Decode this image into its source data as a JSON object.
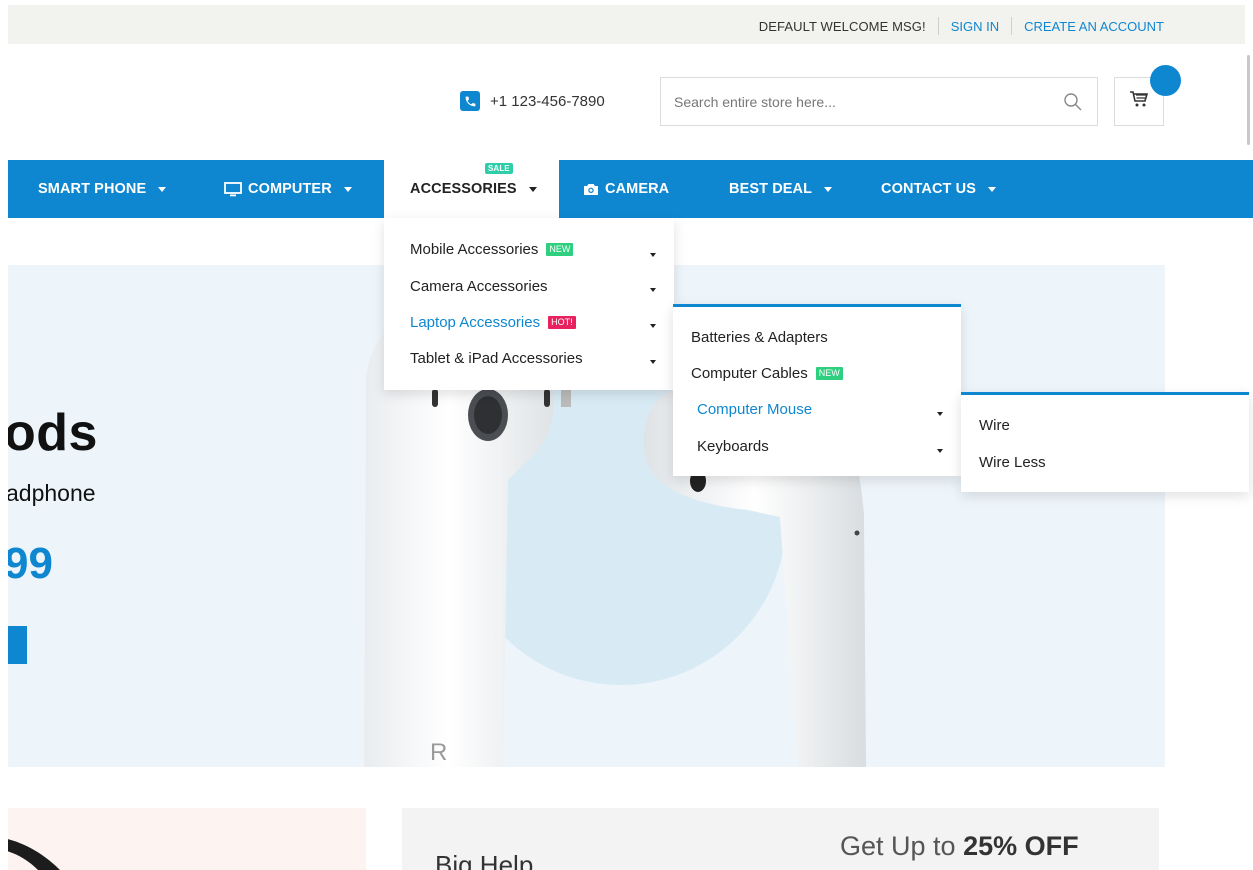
{
  "topbar": {
    "welcome": "DEFAULT WELCOME MSG!",
    "sign_in": "SIGN IN",
    "create_account": "CREATE AN ACCOUNT"
  },
  "header": {
    "phone": "+1 123-456-7890",
    "search_placeholder": "Search entire store here..."
  },
  "nav": {
    "items": [
      {
        "label": "SMART PHONE"
      },
      {
        "label": "COMPUTER"
      },
      {
        "label": "ACCESSORIES",
        "badge": "SALE"
      },
      {
        "label": "CAMERA"
      },
      {
        "label": "BEST DEAL"
      },
      {
        "label": "CONTACT US"
      }
    ]
  },
  "menu_level1": {
    "items": [
      {
        "label": "Mobile Accessories",
        "tag": "NEW"
      },
      {
        "label": "Camera Accessories"
      },
      {
        "label": "Laptop Accessories",
        "tag": "HOT!"
      },
      {
        "label": "Tablet & iPad Accessories"
      }
    ]
  },
  "menu_level2": {
    "items": [
      {
        "label": "Batteries & Adapters"
      },
      {
        "label": "Computer Cables",
        "tag": "NEW"
      },
      {
        "label": "Computer Mouse"
      },
      {
        "label": "Keyboards"
      }
    ]
  },
  "menu_level3": {
    "items": [
      {
        "label": "Wire"
      },
      {
        "label": "Wire Less"
      }
    ]
  },
  "hero": {
    "title": "ods",
    "subtitle": "adphone",
    "price": "99",
    "case_letter": "R"
  },
  "banners": {
    "left_partial": "",
    "right_heading": "Big Help",
    "promo_prefix": "Get Up to ",
    "promo_bold": "25% OFF"
  },
  "colors": {
    "accent": "#0f87d0",
    "tag_new": "#2ecf7e",
    "tag_hot": "#e8215f",
    "tag_sale": "#2ecfa8"
  }
}
